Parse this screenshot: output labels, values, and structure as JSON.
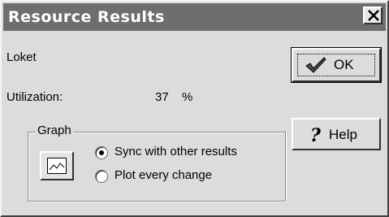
{
  "window": {
    "title": "Resource Results"
  },
  "resource": {
    "name": "Loket"
  },
  "utilization": {
    "label": "Utilization:",
    "value": "37",
    "unit": "%"
  },
  "buttons": {
    "ok_label": "OK",
    "ok_icon": "checkmark-icon",
    "help_label": "Help",
    "help_icon": "question-mark-icon",
    "close_icon": "close-x-icon"
  },
  "graph": {
    "legend": "Graph",
    "graph_button_icon": "line-graph-icon",
    "options": [
      {
        "label": "Sync with other results",
        "selected": true
      },
      {
        "label": "Plot every change",
        "selected": false
      }
    ]
  }
}
